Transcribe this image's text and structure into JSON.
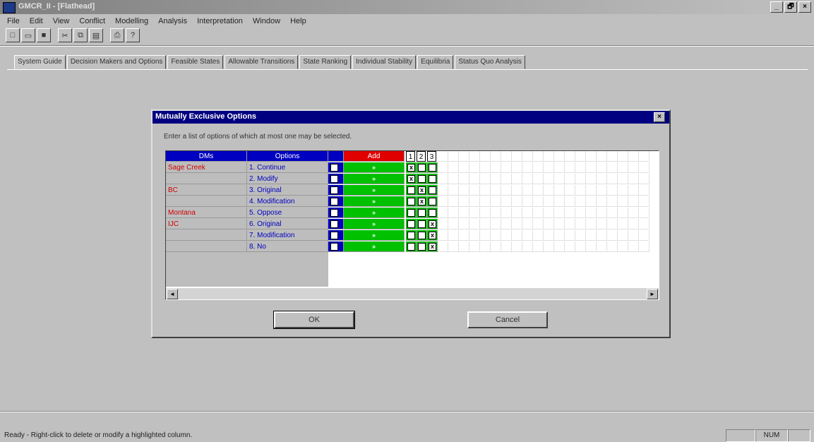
{
  "window": {
    "title": "GMCR_II - [Flathead]",
    "controls": [
      "_",
      "🗗",
      "×"
    ]
  },
  "menu": [
    "File",
    "Edit",
    "View",
    "Conflict",
    "Modelling",
    "Analysis",
    "Interpretation",
    "Window",
    "Help"
  ],
  "toolbar": {
    "buttons": [
      {
        "icon": "new-file-icon",
        "glyph": "□"
      },
      {
        "icon": "open-folder-icon",
        "glyph": "▭"
      },
      {
        "icon": "save-icon",
        "glyph": "■"
      },
      {
        "icon": "cut-icon",
        "glyph": "✂"
      },
      {
        "icon": "copy-icon",
        "glyph": "⧉"
      },
      {
        "icon": "paste-icon",
        "glyph": "▤"
      },
      {
        "icon": "print-icon",
        "glyph": "⎙"
      },
      {
        "icon": "help-icon",
        "glyph": "?"
      }
    ]
  },
  "tabs": [
    "System Guide",
    "Decision Makers and Options",
    "Feasible States",
    "Allowable Transitions",
    "State Ranking",
    "Individual Stability",
    "Equilibria",
    "Status Quo Analysis"
  ],
  "dialog": {
    "title": "Mutually Exclusive Options",
    "close": "×",
    "instruction": "Enter a list of options of which at most one may be selected.",
    "headers": {
      "dms": "DMs",
      "options": "Options",
      "add": "Add",
      "cols": [
        "1",
        "2",
        "3"
      ]
    },
    "rows": [
      {
        "dm": "Sage Creek",
        "option": "1. Continue",
        "add": "»",
        "cols": [
          "x",
          "",
          ""
        ]
      },
      {
        "dm": "",
        "option": "2. Modify",
        "add": "»",
        "cols": [
          "x",
          "",
          ""
        ]
      },
      {
        "dm": "BC",
        "option": "3. Original",
        "add": "»",
        "cols": [
          "",
          "x",
          ""
        ]
      },
      {
        "dm": "",
        "option": "4. Modification",
        "add": "»",
        "cols": [
          "",
          "x",
          ""
        ]
      },
      {
        "dm": "Montana",
        "option": "5. Oppose",
        "add": "»",
        "cols": [
          "",
          "",
          ""
        ]
      },
      {
        "dm": "IJC",
        "option": "6. Original",
        "add": "»",
        "cols": [
          "",
          "",
          "x"
        ]
      },
      {
        "dm": "",
        "option": "7. Modification",
        "add": "»",
        "cols": [
          "",
          "",
          "x"
        ]
      },
      {
        "dm": "",
        "option": "8. No",
        "add": "»",
        "cols": [
          "",
          "",
          "x"
        ]
      }
    ],
    "scroll_left": "◄",
    "scroll_right": "►",
    "ok": "OK",
    "cancel": "Cancel"
  },
  "status": {
    "text": "Ready - Right-click to delete or modify a highlighted column.",
    "num": "NUM"
  },
  "colors": {
    "dm_text": "#d00000",
    "option_text": "#0000c0",
    "header_blue": "#0000c0",
    "add_red": "#e00000",
    "grid_green": "#00c000",
    "dialog_title": "#000080"
  }
}
